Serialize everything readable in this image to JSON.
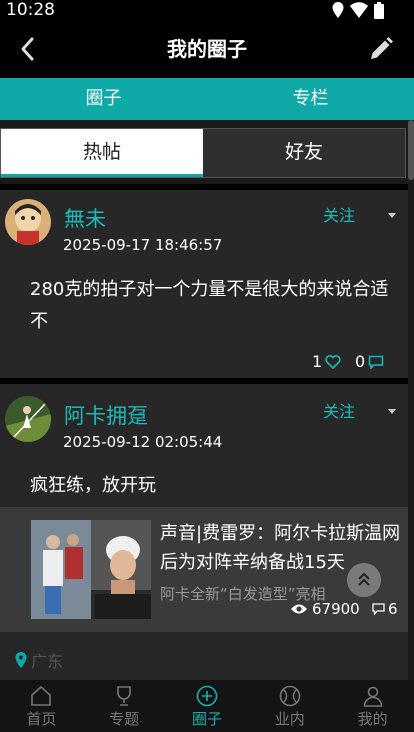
{
  "status": {
    "time": "10:28"
  },
  "header": {
    "title": "我的圈子"
  },
  "main_tabs": [
    "圈子",
    "专栏"
  ],
  "sub_tabs": {
    "active": "热帖",
    "other": "好友"
  },
  "posts": [
    {
      "user": "無未",
      "date": "2025-09-17 18:46:57",
      "follow": "关注",
      "text": "280克的拍子对一个力量不是很大的来说合适不",
      "likes": "1",
      "comments": "0"
    },
    {
      "user": "阿卡拥趸",
      "date": "2025-09-12 02:05:44",
      "follow": "关注",
      "text": "疯狂练，放开玩",
      "news": {
        "title": "声音|费雷罗：阿尔卡拉斯温网后为对阵辛纳备战15天",
        "subtitle": "阿卡全新“白发造型”亮相",
        "views": "67900",
        "comments": "6"
      },
      "location": "广东"
    }
  ],
  "bottom_nav": [
    "首页",
    "专题",
    "圈子",
    "业内",
    "我的"
  ],
  "colors": {
    "accent": "#0fa9a8",
    "background": "#1a1a1a",
    "card": "#272727"
  }
}
